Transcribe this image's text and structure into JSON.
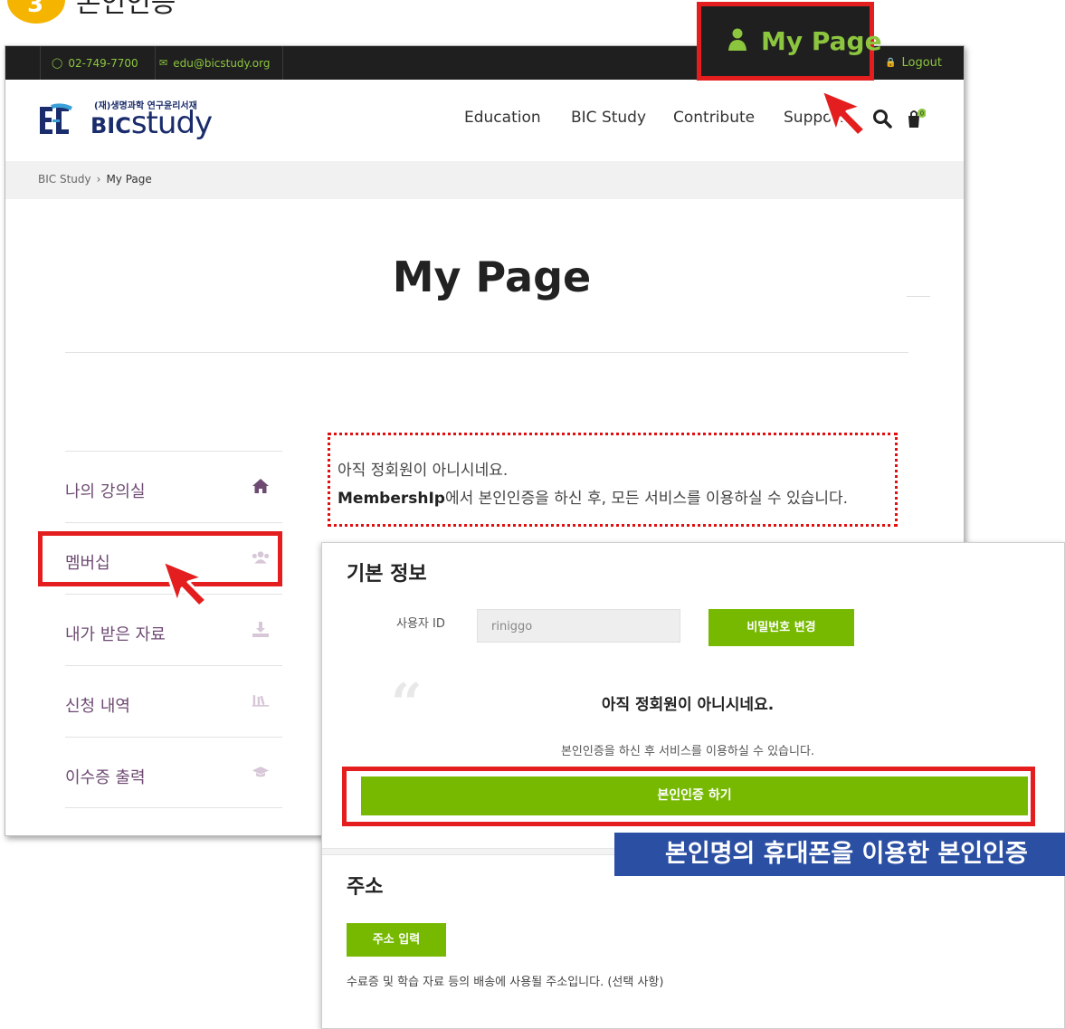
{
  "step": {
    "number": "3",
    "text": "본인인증"
  },
  "topbar": {
    "phone": "02-749-7700",
    "email": "edu@bicstudy.org",
    "logout_label": "Logout",
    "my_page_label": "My Page"
  },
  "header": {
    "logo_sub": "(재)생명과학 연구윤리서재",
    "logo_main_bold": "BIC",
    "logo_main_rest": "study",
    "nav": [
      "Education",
      "BIC Study",
      "Contribute",
      "Support"
    ],
    "cart_count": "0"
  },
  "breadcrumb": {
    "home": "BIC Study",
    "separator": "›",
    "current": "My Page"
  },
  "page_title": "My Page",
  "sidebar": {
    "items": [
      {
        "label": "나의 강의실",
        "icon": "home-icon"
      },
      {
        "label": "멤버십",
        "icon": "users-icon"
      },
      {
        "label": "내가 받은 자료",
        "icon": "download-icon"
      },
      {
        "label": "신청 내역",
        "icon": "library-icon"
      },
      {
        "label": "이수증 출력",
        "icon": "graduation-cap-icon"
      }
    ]
  },
  "notice_box": {
    "line1": "아직 정회원이 아니시네요.",
    "line2_bold": "MembershIp",
    "line2_rest": "에서 본인인증을 하신 후, 모든 서비스를 이용하실 수 있습니다."
  },
  "panel": {
    "basic_title": "기본 정보",
    "user_id_label": "사용자 ID",
    "user_id_value": "riniggo",
    "change_password_button": "비밀번호 변경",
    "notice_title": "아직 정회원이 아니시네요.",
    "notice_desc": "본인인증을 하신 후 서비스를 이용하실 수 있습니다.",
    "verify_button": "본인인증 하기",
    "address_title": "주소",
    "address_button": "주소 입력",
    "address_desc": "수료증 및 학습 자료 등의 배송에 사용될 주소입니다. (선택 사항)"
  },
  "caption": "본인명의 휴대폰을 이용한 본인인증",
  "colors": {
    "accent_green": "#76b900",
    "highlight_red": "#e41e1e",
    "caption_blue": "#2b4fa3",
    "topbar": "#1f1f1f"
  }
}
